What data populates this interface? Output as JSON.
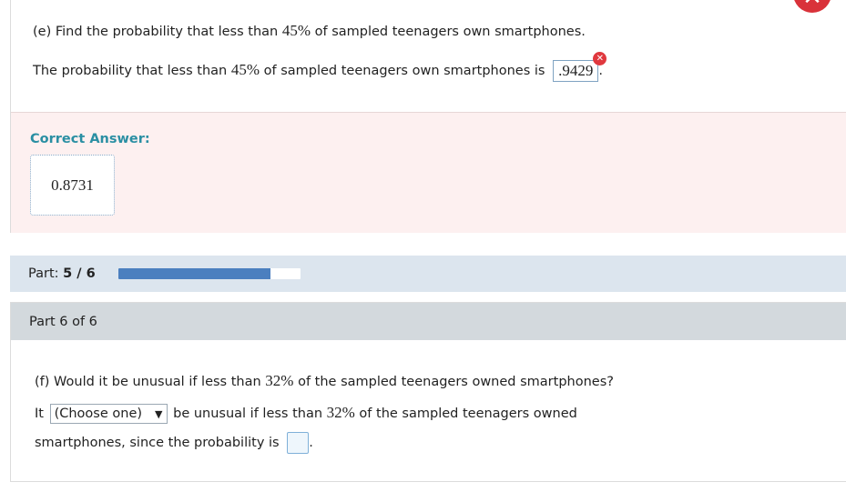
{
  "part_e": {
    "question_prefix": "(e) Find the probability that less than ",
    "question_pct": "45%",
    "question_suffix": " of sampled teenagers own smartphones.",
    "statement_prefix": "The probability that less than ",
    "statement_pct": "45%",
    "statement_suffix": " of sampled teenagers own smartphones is",
    "submitted_answer": ".9429",
    "trailing_period": ".",
    "wrong_mark_glyph": "✕"
  },
  "error_badge_glyph": "✕",
  "correct_answer": {
    "title": "Correct Answer:",
    "value": "0.8731"
  },
  "progress": {
    "label_prefix": "Part: ",
    "label_value": "5 / 6",
    "fraction": 0.833,
    "fill_color": "#4b7fbf"
  },
  "part_6": {
    "title": "Part 6 of 6",
    "question_prefix": "(f) Would it be unusual if less than ",
    "question_pct": "32%",
    "question_suffix": " of the sampled teenagers owned smartphones?",
    "line2_prefix": "It",
    "select_value": "(Choose one)",
    "select_caret": "▼",
    "line2_middle": "be unusual if less than ",
    "line2_pct": "32%",
    "line2_suffix": " of the sampled teenagers owned",
    "line3_prefix": "smartphones, since the probability is",
    "line3_period": "."
  },
  "colors": {
    "error_red": "#d9323a",
    "correct_panel_bg": "#fdf0f0",
    "correct_title": "#2a8fa3",
    "part_bar_bg": "#dce5ee",
    "part6_header_bg": "#d3d9dd"
  }
}
